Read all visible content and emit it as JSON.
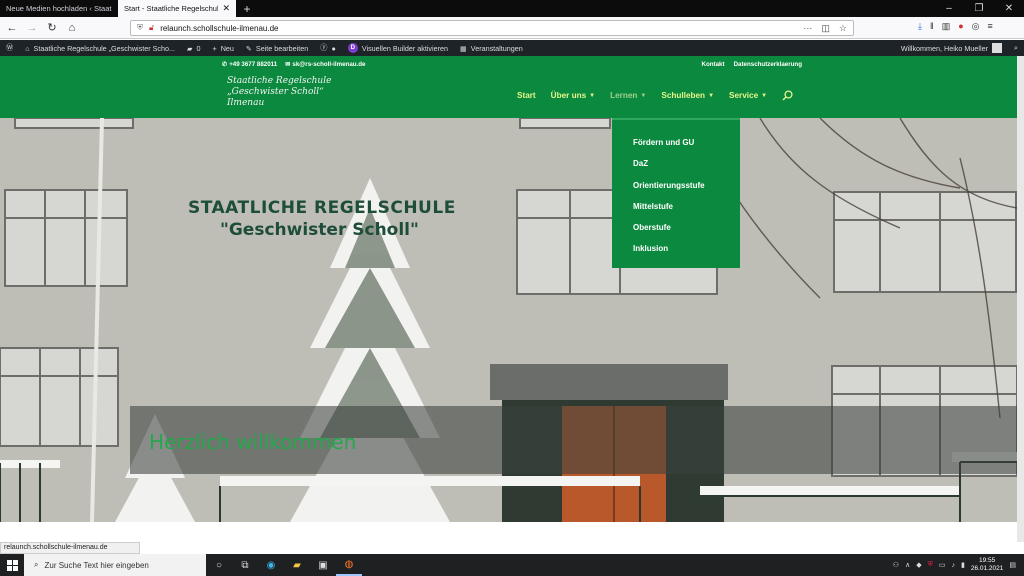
{
  "browser": {
    "tabs": [
      {
        "title": "Neue Medien hochladen ‹ Staatlich"
      },
      {
        "title": "Start - Staatliche Regelschule „Ges"
      }
    ],
    "url_domain": "relaunch.schollschule-ilmenau.de"
  },
  "wp_admin_bar": {
    "site_name": "Staatliche Regelschule „Geschwister Scho...",
    "comments_count": "0",
    "new_label": "Neu",
    "edit_label": "Seite bearbeiten",
    "builder_label": "Visuellen Builder aktivieren",
    "events_label": "Veranstaltungen",
    "greeting": "Willkommen, Heiko Mueller"
  },
  "site": {
    "phone": "+49 3677 882011",
    "email": "sk@rs-scholl-ilmenau.de",
    "top_links": [
      "Kontakt",
      "Datenschutzerklaerung"
    ],
    "logo_lines": [
      "Staatliche Regelschule",
      "„Geschwister Scholl“",
      "Ilmenau"
    ],
    "menu": [
      {
        "label": "Start",
        "has_children": false
      },
      {
        "label": "Über uns",
        "has_children": true
      },
      {
        "label": "Lernen",
        "has_children": true
      },
      {
        "label": "Schulleben",
        "has_children": true
      },
      {
        "label": "Service",
        "has_children": true
      }
    ],
    "dropdown": [
      "Fördern und GU",
      "DaZ",
      "Orientierungsstufe",
      "Mittelstufe",
      "Oberstufe",
      "Inklusion"
    ],
    "hero": {
      "building_sign_line1": "STAATLICHE REGELSCHULE",
      "building_sign_line2": "\"Geschwister Scholl\"",
      "welcome": "Herzlich willkommen",
      "slide_count": 2,
      "active_slide": 1
    }
  },
  "status_url": "relaunch.schollschule-ilmenau.de",
  "taskbar": {
    "search_placeholder": "Zur Suche Text hier eingeben",
    "time": "19:55",
    "date": "26.01.2021"
  },
  "colors": {
    "brand_green": "#0b8a3f",
    "menu_text": "#e6f58a",
    "welcome_text": "#23a84e"
  }
}
